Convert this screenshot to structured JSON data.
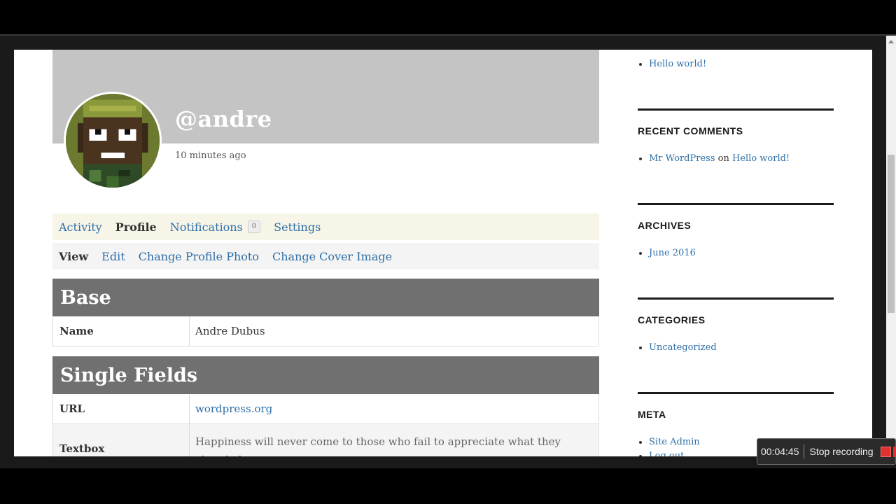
{
  "profile": {
    "username": "@andre",
    "last_active": "10 minutes ago"
  },
  "nav_main": [
    {
      "label": "Activity",
      "current": false
    },
    {
      "label": "Profile",
      "current": true
    },
    {
      "label": "Notifications",
      "current": false,
      "count": "0"
    },
    {
      "label": "Settings",
      "current": false
    }
  ],
  "nav_sub": [
    {
      "label": "View",
      "current": true
    },
    {
      "label": "Edit",
      "current": false
    },
    {
      "label": "Change Profile Photo",
      "current": false
    },
    {
      "label": "Change Cover Image",
      "current": false
    }
  ],
  "groups": {
    "base": {
      "title": "Base",
      "fields": [
        {
          "label": "Name",
          "value": "Andre Dubus"
        }
      ]
    },
    "single": {
      "title": "Single Fields",
      "fields": [
        {
          "label": "URL",
          "value": "wordpress.org"
        },
        {
          "label": "Textbox",
          "value": "Happiness will never come to those who fail to appreciate what they already have."
        }
      ]
    }
  },
  "sidebar": {
    "recent_posts": [
      "Hello world!"
    ],
    "recent_comments": {
      "title": "RECENT COMMENTS",
      "author": "Mr WordPress",
      "connector": "on",
      "post": "Hello world!"
    },
    "archives": {
      "title": "ARCHIVES",
      "items": [
        "June 2016"
      ]
    },
    "categories": {
      "title": "CATEGORIES",
      "items": [
        "Uncategorized"
      ]
    },
    "meta": {
      "title": "META",
      "items": [
        "Site Admin",
        "Log out"
      ]
    }
  },
  "recorder": {
    "time": "00:04:45",
    "stop_label": "Stop recording",
    "accent": "#e03030"
  }
}
